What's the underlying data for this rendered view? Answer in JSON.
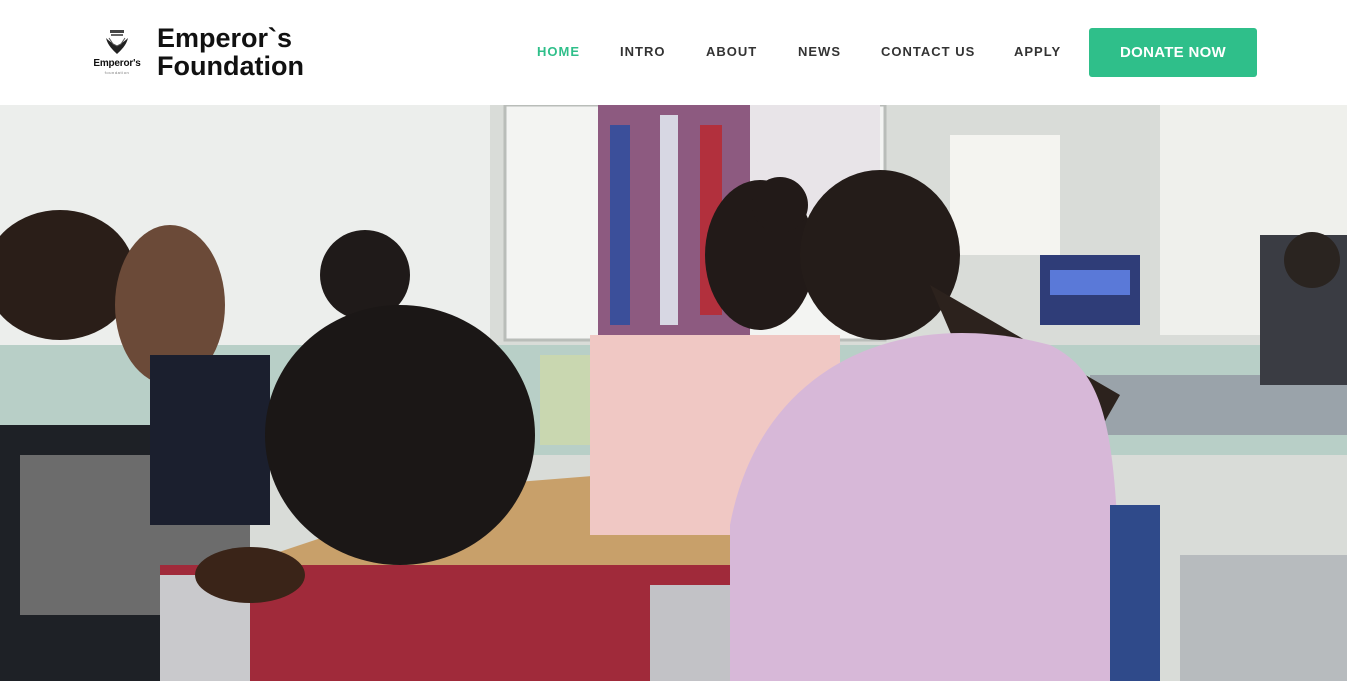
{
  "brand": {
    "logo_text": "Emperor's",
    "logo_subtext": "foundation",
    "name_line1": "Emperor`s",
    "name_line2": "Foundation"
  },
  "nav": {
    "items": [
      {
        "label": "HOME",
        "active": true
      },
      {
        "label": "INTRO",
        "active": false
      },
      {
        "label": "ABOUT",
        "active": false
      },
      {
        "label": "NEWS",
        "active": false
      },
      {
        "label": "CONTACT US",
        "active": false
      },
      {
        "label": "APPLY",
        "active": false
      }
    ],
    "cta_label": "DONATE NOW"
  },
  "colors": {
    "accent": "#2fbf8a",
    "nav_text": "#333333"
  },
  "hero": {
    "image": "classroom-photo"
  }
}
